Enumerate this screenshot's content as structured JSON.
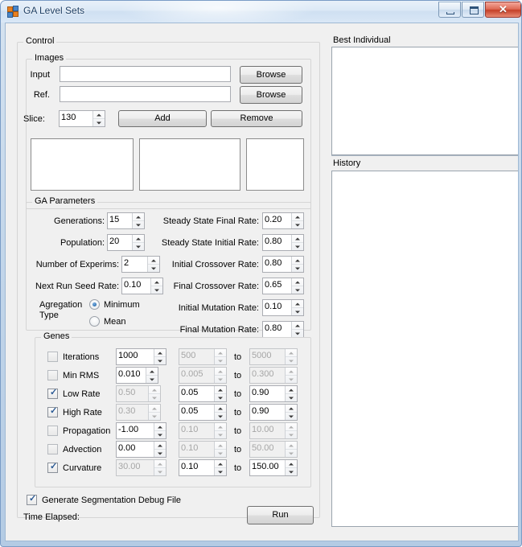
{
  "window": {
    "title": "GA Level Sets",
    "icon": "app-icon",
    "buttons": {
      "minimize": "minimize-icon",
      "maximize": "maximize-icon",
      "close": "✕"
    }
  },
  "control": {
    "legend": "Control",
    "images": {
      "legend": "Images",
      "input_label": "Input",
      "input_value": "",
      "input_placeholder": "",
      "ref_label": "Ref.",
      "ref_value": "",
      "ref_placeholder": "",
      "browse_input_label": "Browse",
      "browse_ref_label": "Browse",
      "slice_label": "Slice:",
      "slice_value": "130",
      "add_label": "Add",
      "remove_label": "Remove",
      "previews": [
        "preview-1",
        "preview-2",
        "preview-3"
      ]
    },
    "ga_parameters": {
      "legend": "GA Parameters",
      "left": [
        {
          "label": "Generations:",
          "value": "15"
        },
        {
          "label": "Population:",
          "value": "20"
        },
        {
          "label": "Number of Experims:",
          "value": "2"
        },
        {
          "label": "Next Run Seed Rate:",
          "value": "0.10"
        }
      ],
      "right": [
        {
          "label": "Steady State Final Rate:",
          "value": "0.20"
        },
        {
          "label": "Steady State Initial Rate:",
          "value": "0.80"
        },
        {
          "label": "Initial Crossover Rate:",
          "value": "0.80"
        },
        {
          "label": "Final Crossover Rate:",
          "value": "0.65"
        },
        {
          "label": "Initial Mutation Rate:",
          "value": "0.10"
        },
        {
          "label": "Final Mutation Rate:",
          "value": "0.80"
        }
      ],
      "aggregation": {
        "label_line1": "Agregation",
        "label_line2": "Type",
        "options": [
          {
            "label": "Minimum",
            "selected": true
          },
          {
            "label": "Mean",
            "selected": false
          }
        ]
      }
    },
    "genes": {
      "legend": "Genes",
      "range_separator": "to",
      "rows": [
        {
          "name": "Iterations",
          "checked": false,
          "fixed": "1000",
          "fixed_enabled": true,
          "min": "500",
          "max": "5000",
          "range_enabled": false
        },
        {
          "name": "Min RMS",
          "checked": false,
          "fixed": "0.010",
          "fixed_enabled": true,
          "min": "0.005",
          "max": "0.300",
          "range_enabled": false
        },
        {
          "name": "Low Rate",
          "checked": true,
          "fixed": "0.50",
          "fixed_enabled": false,
          "min": "0.05",
          "max": "0.90",
          "range_enabled": true
        },
        {
          "name": "High Rate",
          "checked": true,
          "fixed": "0.30",
          "fixed_enabled": false,
          "min": "0.05",
          "max": "0.90",
          "range_enabled": true
        },
        {
          "name": "Propagation",
          "checked": false,
          "fixed": "-1.00",
          "fixed_enabled": true,
          "min": "0.10",
          "max": "10.00",
          "range_enabled": false
        },
        {
          "name": "Advection",
          "checked": false,
          "fixed": "0.00",
          "fixed_enabled": true,
          "min": "0.10",
          "max": "50.00",
          "range_enabled": false
        },
        {
          "name": "Curvature",
          "checked": true,
          "fixed": "30.00",
          "fixed_enabled": false,
          "min": "0.10",
          "max": "150.00",
          "range_enabled": true
        }
      ]
    },
    "debug_checkbox": {
      "label": "Generate Segmentation Debug File",
      "checked": true
    },
    "time_elapsed_label": "Time Elapsed:",
    "time_elapsed_value": "",
    "run_label": "Run"
  },
  "right": {
    "best_individual": {
      "label": "Best Individual",
      "content": ""
    },
    "history": {
      "label": "History",
      "content": ""
    }
  },
  "colors": {
    "accent": "#2f6fae",
    "close_button": "#c44028",
    "window_chrome": "#b4cbe4",
    "client_background": "#f0f0f0",
    "field_background": "#ffffff",
    "disabled_text": "#a6a6a6"
  }
}
